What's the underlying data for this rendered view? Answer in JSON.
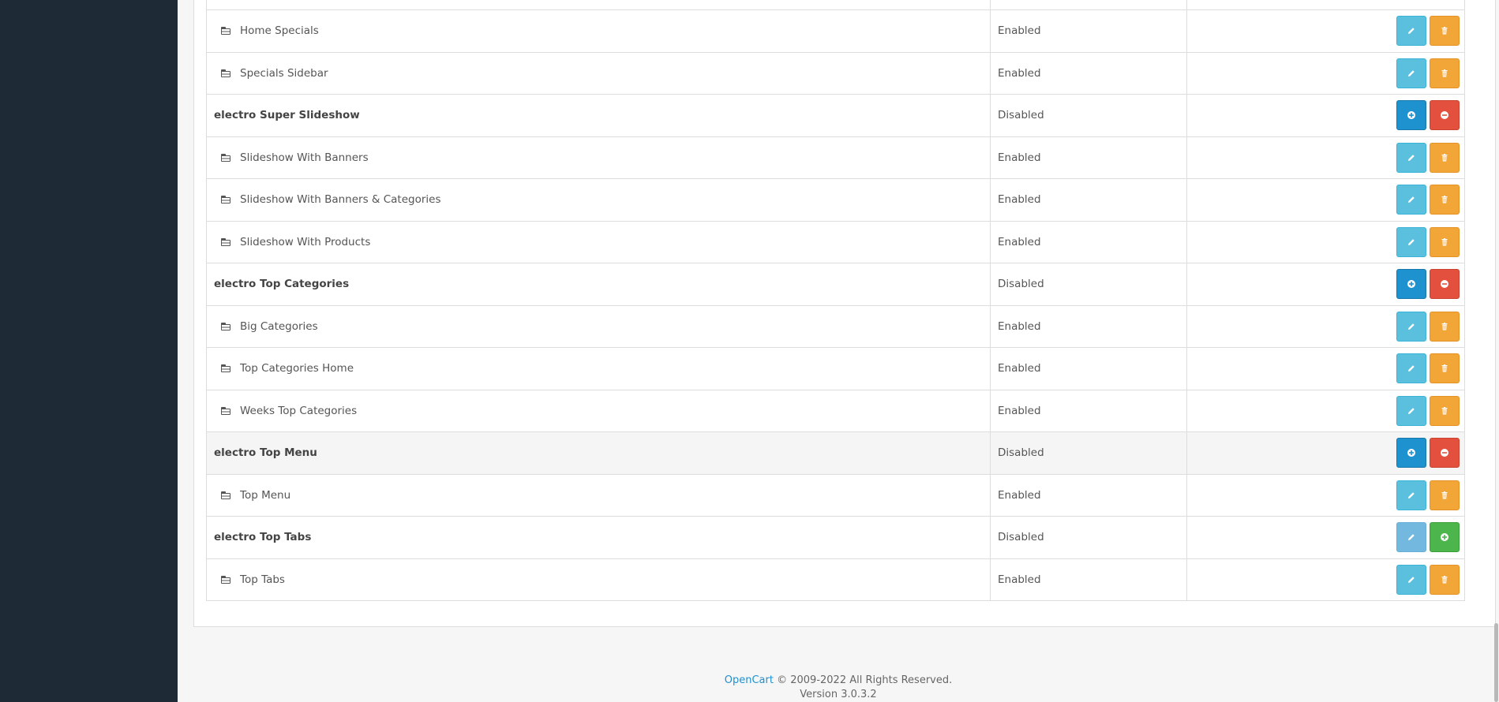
{
  "rows": [
    {
      "name": "Home Specials",
      "status": "Enabled",
      "type": "child"
    },
    {
      "name": "Specials Sidebar",
      "status": "Enabled",
      "type": "child"
    },
    {
      "name": "electro Super Slideshow",
      "status": "Disabled",
      "type": "parent"
    },
    {
      "name": "Slideshow With Banners",
      "status": "Enabled",
      "type": "child"
    },
    {
      "name": "Slideshow With Banners & Categories",
      "status": "Enabled",
      "type": "child"
    },
    {
      "name": "Slideshow With Products",
      "status": "Enabled",
      "type": "child"
    },
    {
      "name": "electro Top Categories",
      "status": "Disabled",
      "type": "parent"
    },
    {
      "name": "Big Categories",
      "status": "Enabled",
      "type": "child"
    },
    {
      "name": "Top Categories Home",
      "status": "Enabled",
      "type": "child"
    },
    {
      "name": "Weeks Top Categories",
      "status": "Enabled",
      "type": "child"
    },
    {
      "name": "electro Top Menu",
      "status": "Disabled",
      "type": "parent"
    },
    {
      "name": "Top Menu",
      "status": "Enabled",
      "type": "child"
    },
    {
      "name": "electro Top Tabs",
      "status": "Disabled",
      "type": "parent-installed"
    },
    {
      "name": "Top Tabs",
      "status": "Enabled",
      "type": "child"
    }
  ],
  "icons": {
    "child": "folder-open-icon",
    "edit": "pencil-icon",
    "delete": "trash-icon",
    "install": "plus-circle-icon",
    "uninstall": "minus-circle-icon"
  },
  "footer": {
    "brand": "OpenCart",
    "copyright": " © 2009-2022 All Rights Reserved.",
    "version": "Version 3.0.3.2"
  },
  "colors": {
    "sidebar": "#1e2a36",
    "info": "#5bc0de",
    "warning": "#f3a638",
    "primary": "#1e91cf",
    "danger": "#e3503e",
    "success": "#4cb64c"
  }
}
